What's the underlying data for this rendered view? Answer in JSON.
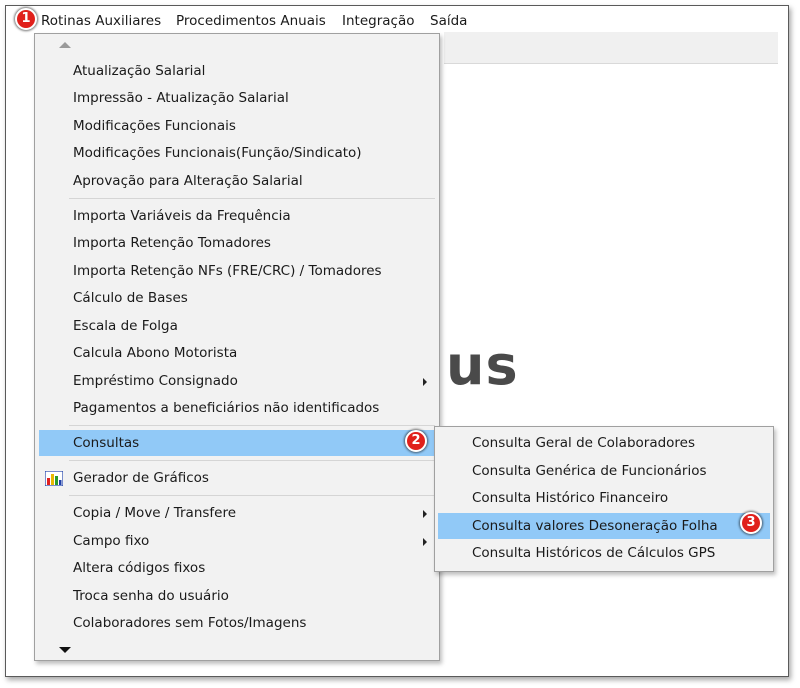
{
  "menubar": {
    "items": [
      {
        "label": "Rotinas Auxiliares"
      },
      {
        "label": "Procedimentos Anuais"
      },
      {
        "label": "Integração"
      },
      {
        "label": "Saída"
      }
    ]
  },
  "background": {
    "partial_text": "us"
  },
  "menu": {
    "items": [
      "Atualização Salarial",
      "Impressão - Atualização Salarial",
      "Modificações Funcionais",
      "Modificações Funcionais(Função/Sindicato)",
      "Aprovação para Alteração Salarial",
      "Importa Variáveis da Frequência",
      "Importa Retenção Tomadores",
      "Importa Retenção NFs (FRE/CRC) / Tomadores",
      "Cálculo de Bases",
      "Escala de Folga",
      "Calcula Abono Motorista",
      "Empréstimo Consignado",
      "Pagamentos a beneficiários não identificados",
      "Consultas",
      "Gerador de Gráficos",
      "Copia / Move / Transfere",
      "Campo fixo",
      "Altera códigos fixos",
      "Troca senha do usuário",
      "Colaboradores sem Fotos/Imagens"
    ]
  },
  "submenu": {
    "items": [
      "Consulta Geral de Colaboradores",
      "Consulta Genérica de Funcionários",
      "Consulta Histórico Financeiro",
      "Consulta valores Desoneração Folha",
      "Consulta Históricos de Cálculos GPS"
    ]
  },
  "badges": [
    "1",
    "2",
    "3"
  ],
  "colors": {
    "highlight": "#91c9f7",
    "badge": "#e0201b",
    "menu_bg": "#f2f2f2"
  }
}
